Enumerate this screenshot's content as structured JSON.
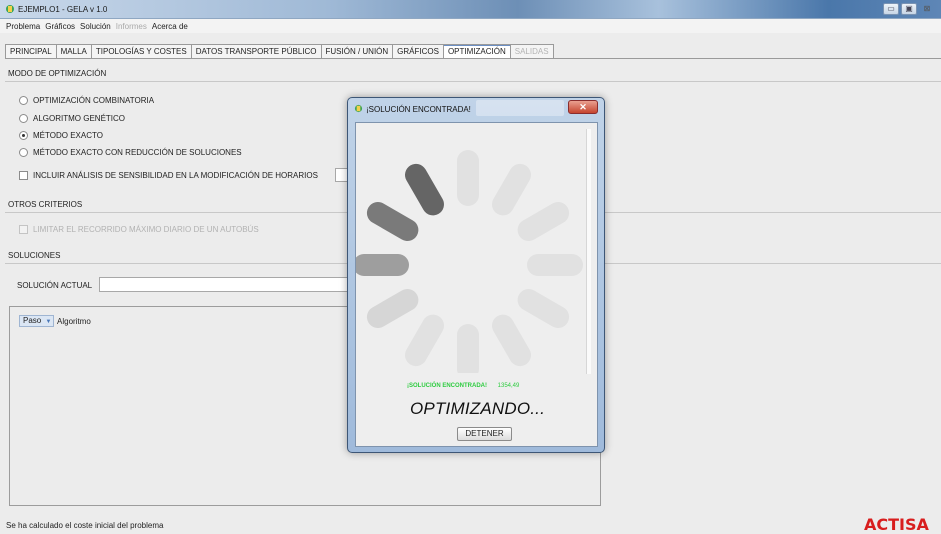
{
  "window": {
    "title": "EJEMPLO1 - GELA v 1.0",
    "controls": [
      "▭",
      "▣",
      "⊠"
    ]
  },
  "menu": [
    {
      "label": "Problema",
      "disabled": false
    },
    {
      "label": "Gráficos",
      "disabled": false
    },
    {
      "label": "Solución",
      "disabled": false
    },
    {
      "label": "Informes",
      "disabled": true
    },
    {
      "label": "Acerca de",
      "disabled": false
    }
  ],
  "tabs": [
    {
      "label": "PRINCIPAL",
      "state": "normal"
    },
    {
      "label": "MALLA",
      "state": "normal"
    },
    {
      "label": "TIPOLOGÍAS Y COSTES",
      "state": "normal"
    },
    {
      "label": "DATOS TRANSPORTE PÚBLICO",
      "state": "normal"
    },
    {
      "label": "FUSIÓN / UNIÓN",
      "state": "normal"
    },
    {
      "label": "GRÁFICOS",
      "state": "normal"
    },
    {
      "label": "OPTIMIZACIÓN",
      "state": "active"
    },
    {
      "label": "SALIDAS",
      "state": "disabled"
    }
  ],
  "optimization": {
    "section_title": "MODO DE OPTIMIZACIÓN",
    "modes": [
      {
        "label": "OPTIMIZACIÓN COMBINATORIA",
        "selected": false
      },
      {
        "label": "ALGORITMO GENÉTICO",
        "selected": false
      },
      {
        "label": "MÉTODO EXACTO",
        "selected": true
      },
      {
        "label": "MÉTODO EXACTO CON REDUCCIÓN DE SOLUCIONES",
        "selected": false
      }
    ],
    "sensitivity_label": "INCLUIR ANÁLISIS DE SENSIBILIDAD EN LA MODIFICACIÓN DE HORARIOS"
  },
  "other_criteria": {
    "section_title": "OTROS CRITERIOS",
    "limit_label": "LIMITAR EL RECORRIDO MÁXIMO DIARIO DE UN AUTOBÚS"
  },
  "solutions": {
    "section_title": "SOLUCIONES",
    "current_label": "SOLUCIÓN ACTUAL",
    "current_value": "",
    "table_headers": {
      "paso": "Paso",
      "sort_icon": "▼",
      "algoritmo": "Algoritmo"
    }
  },
  "status_text": "Se ha calculado el coste inicial del problema",
  "logo_text": "ACTISA",
  "dialog": {
    "title": "¡SOLUCIÓN ENCONTRADA!",
    "close_glyph": "✕",
    "found_label": "¡SOLUCIÓN ENCONTRADA!",
    "found_value": "1354,49",
    "status": "OPTIMIZANDO...",
    "stop_button": "DETENER"
  },
  "colors": {
    "found_green": "#2ecc40",
    "logo_red": "#d81e1e",
    "active_tab": "#6b8fc4"
  }
}
